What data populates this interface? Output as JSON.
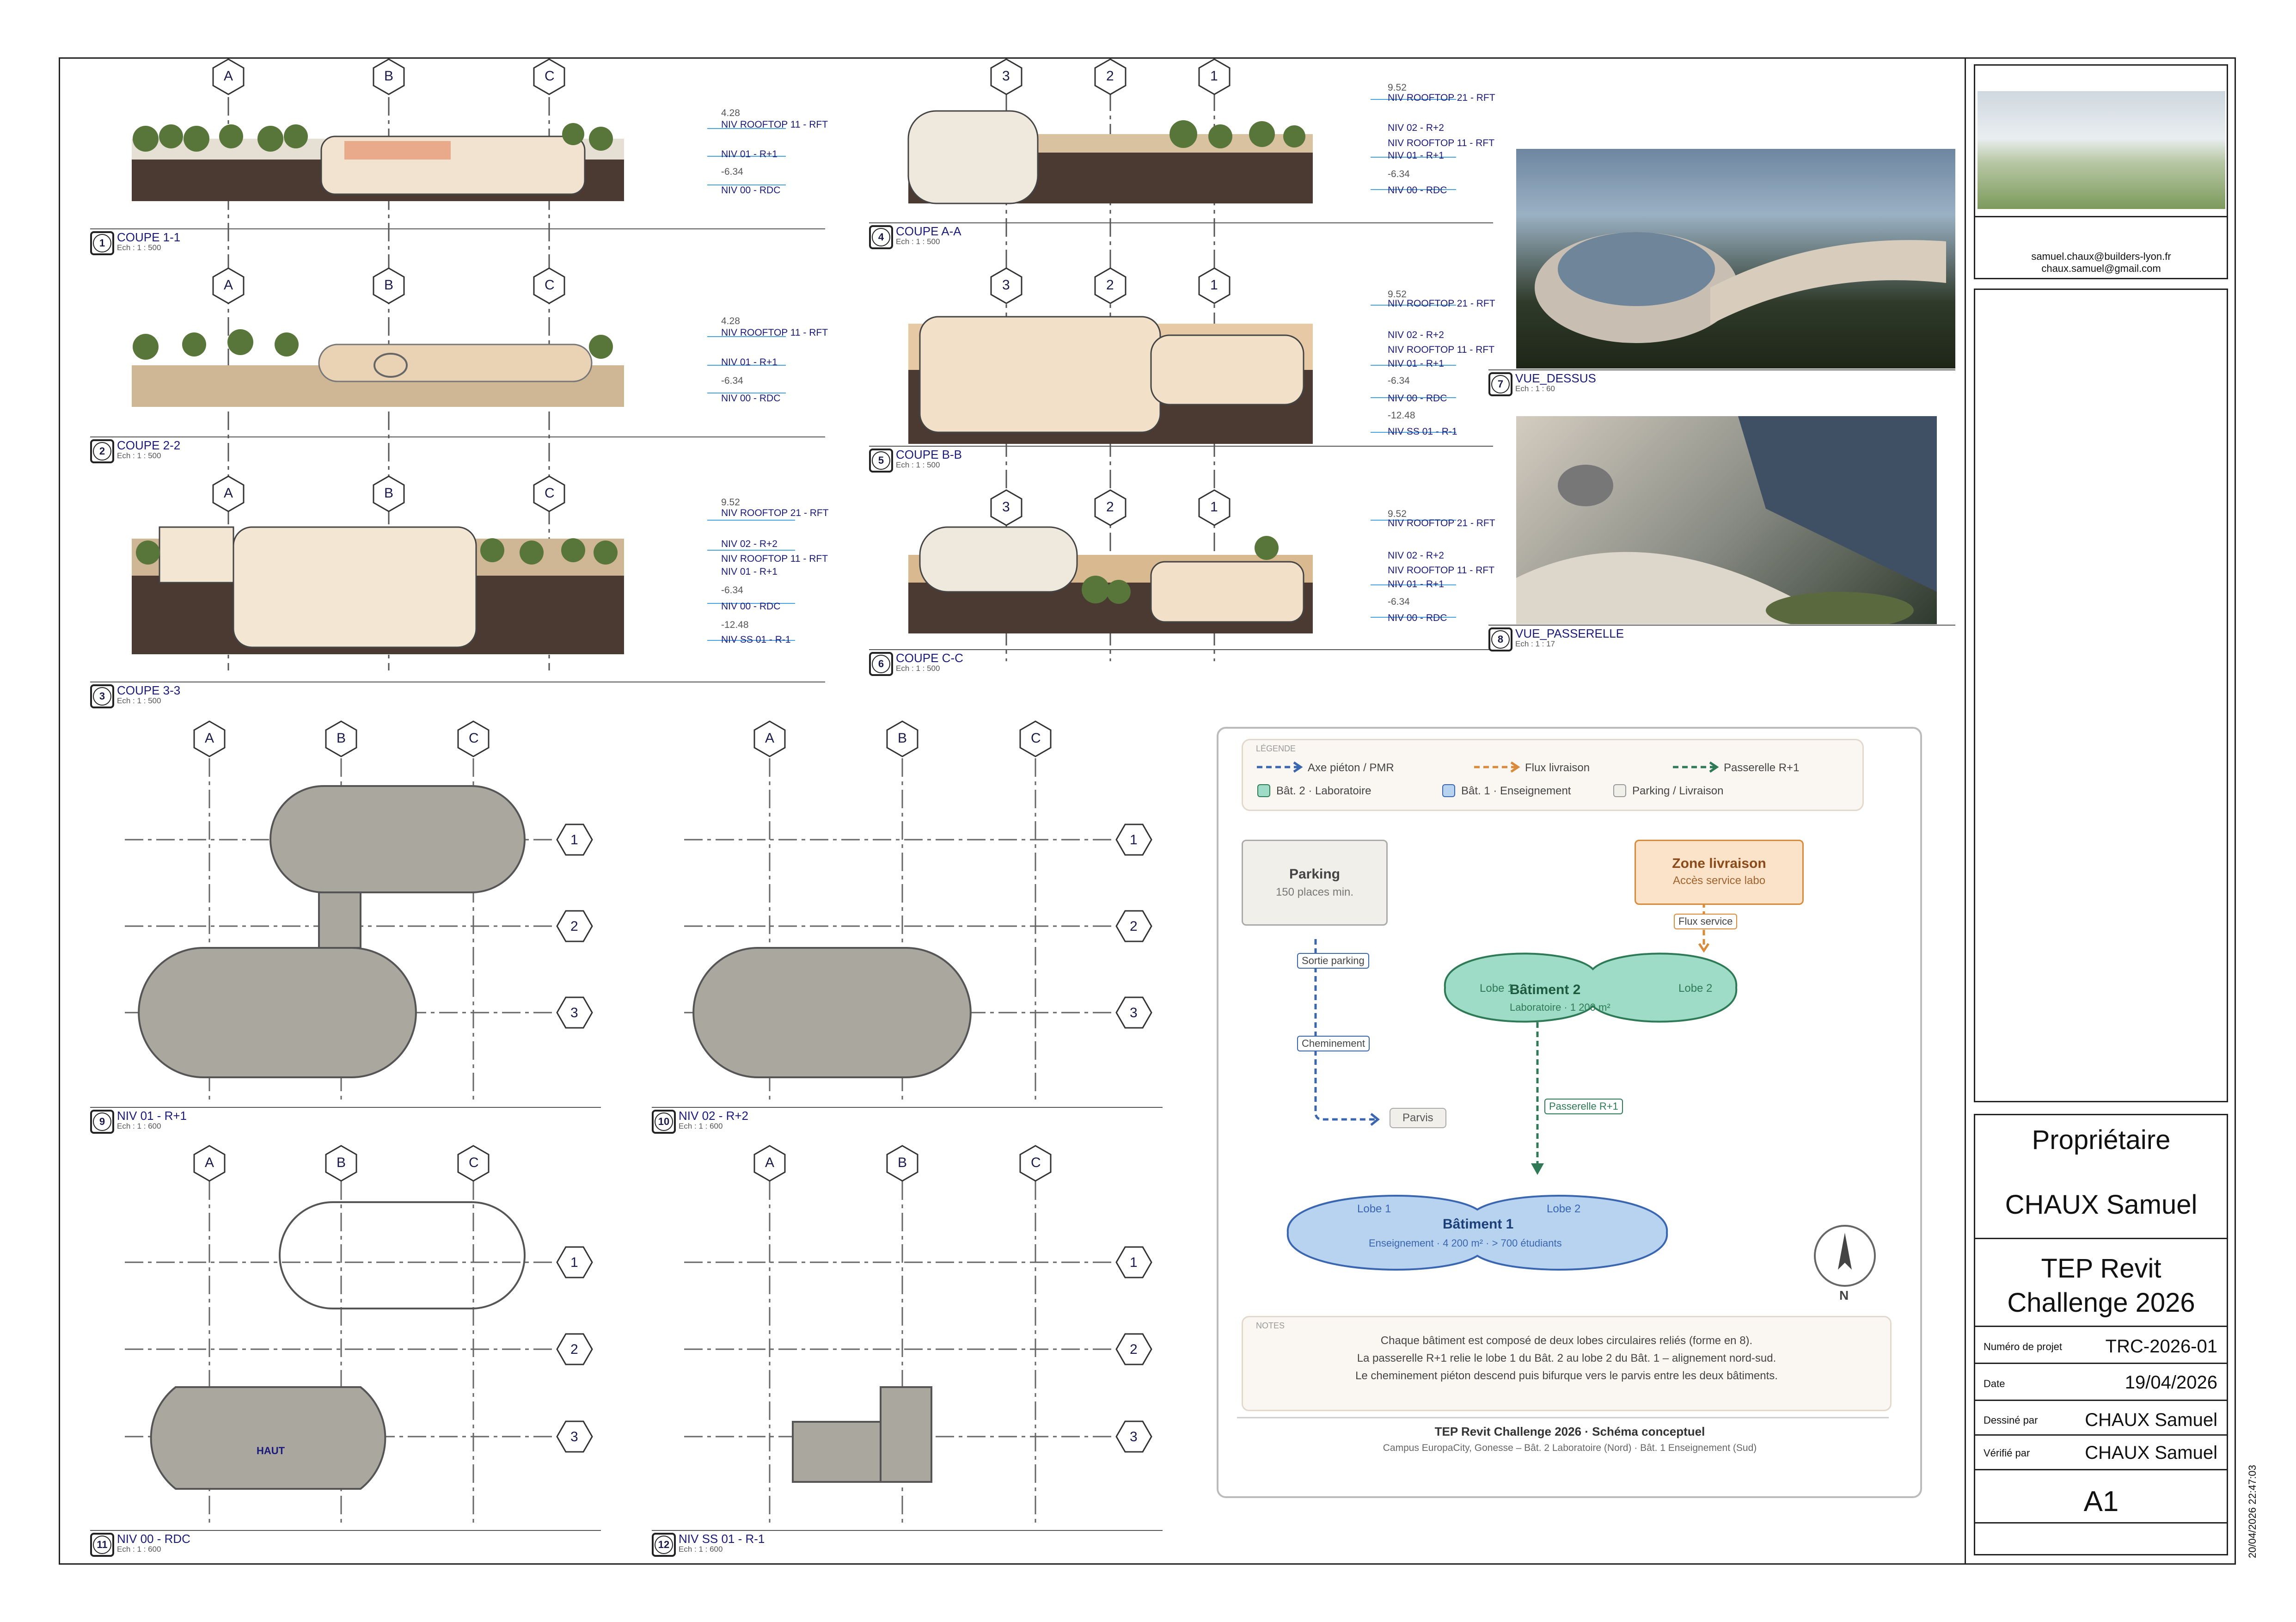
{
  "grid_letters": [
    "A",
    "B",
    "C"
  ],
  "grid_numbers": [
    "3",
    "2",
    "1"
  ],
  "plan_grid_numbers": [
    "1",
    "2",
    "3"
  ],
  "sections": {
    "coupe_1_1": {
      "num": "1",
      "name": "COUPE 1-1",
      "scale": "Ech : 1 : 500",
      "levels": [
        {
          "value": "4.28",
          "label": "NIV ROOFTOP 11 - RFT"
        },
        {
          "value": "",
          "label": "NIV 01 - R+1"
        },
        {
          "value": "-6.34",
          "label": "NIV 00 - RDC"
        }
      ]
    },
    "coupe_2_2": {
      "num": "2",
      "name": "COUPE 2-2",
      "scale": "Ech : 1 : 500",
      "levels": [
        {
          "value": "4.28",
          "label": "NIV ROOFTOP 11 - RFT"
        },
        {
          "value": "",
          "label": "NIV 01 - R+1"
        },
        {
          "value": "-6.34",
          "label": "NIV 00 - RDC"
        }
      ]
    },
    "coupe_3_3": {
      "num": "3",
      "name": "COUPE 3-3",
      "scale": "Ech : 1 : 500",
      "levels": [
        {
          "value": "9.52",
          "label": "NIV ROOFTOP 21 - RFT"
        },
        {
          "value": "",
          "label": "NIV 02 - R+2"
        },
        {
          "value": "",
          "label": "NIV ROOFTOP 11 - RFT"
        },
        {
          "value": "",
          "label": "NIV 01 - R+1"
        },
        {
          "value": "",
          "label": "NIV 00 - RDC"
        },
        {
          "value": "-6.34",
          "label": ""
        },
        {
          "value": "-12.48",
          "label": "NIV SS 01 - R-1"
        }
      ]
    },
    "coupe_a_a": {
      "num": "4",
      "name": "COUPE A-A",
      "scale": "Ech : 1 : 500",
      "levels": [
        {
          "value": "9.52",
          "label": "NIV ROOFTOP 21 - RFT"
        },
        {
          "value": "",
          "label": "NIV 02 - R+2"
        },
        {
          "value": "",
          "label": "NIV ROOFTOP 11 - RFT"
        },
        {
          "value": "",
          "label": "NIV 01 - R+1"
        },
        {
          "value": "-6.34",
          "label": "NIV 00 - RDC"
        }
      ]
    },
    "coupe_b_b": {
      "num": "5",
      "name": "COUPE B-B",
      "scale": "Ech : 1 : 500",
      "levels": [
        {
          "value": "9.52",
          "label": "NIV ROOFTOP 21 - RFT"
        },
        {
          "value": "",
          "label": "NIV 02 - R+2"
        },
        {
          "value": "",
          "label": "NIV ROOFTOP 11 - RFT"
        },
        {
          "value": "",
          "label": "NIV 01 - R+1"
        },
        {
          "value": "",
          "label": "NIV 00 - RDC"
        },
        {
          "value": "-6.34",
          "label": ""
        },
        {
          "value": "-12.48",
          "label": "NIV SS 01 - R-1"
        }
      ]
    },
    "coupe_c_c": {
      "num": "6",
      "name": "COUPE C-C",
      "scale": "Ech : 1 : 500",
      "levels": [
        {
          "value": "9.52",
          "label": "NIV ROOFTOP 21 - RFT"
        },
        {
          "value": "",
          "label": "NIV 02 - R+2"
        },
        {
          "value": "",
          "label": "NIV ROOFTOP 11 - RFT"
        },
        {
          "value": "",
          "label": "NIV 01 - R+1"
        },
        {
          "value": "-6.34",
          "label": "NIV 00 - RDC"
        }
      ]
    }
  },
  "views": {
    "vue_dessus": {
      "num": "7",
      "name": "VUE_DESSUS",
      "scale": "Ech : 1 : 60"
    },
    "vue_passerelle": {
      "num": "8",
      "name": "VUE_PASSERELLE",
      "scale": "Ech : 1 : 17"
    }
  },
  "plans": {
    "niv01": {
      "num": "9",
      "name": "NIV 01 - R+1",
      "scale": "Ech : 1 : 600"
    },
    "niv02": {
      "num": "10",
      "name": "NIV 02 - R+2",
      "scale": "Ech : 1 : 600"
    },
    "niv00": {
      "num": "11",
      "name": "NIV 00 - RDC",
      "scale": "Ech : 1 : 600",
      "tag": "HAUT"
    },
    "nivss01": {
      "num": "12",
      "name": "NIV SS 01 - R-1",
      "scale": "Ech : 1 : 600"
    }
  },
  "diagram": {
    "legend_title": "LÉGENDE",
    "legend": [
      {
        "label": "Axe piéton / PMR",
        "color": "#3a66b0"
      },
      {
        "label": "Flux livraison",
        "color": "#d98a3a"
      },
      {
        "label": "Passerelle R+1",
        "color": "#2e7a56"
      },
      {
        "label": "Bât. 2 · Laboratoire",
        "color": "#9fdcc8"
      },
      {
        "label": "Bât. 1 · Enseignement",
        "color": "#b8d3f0"
      },
      {
        "label": "Parking / Livraison",
        "color": "#f1efea"
      }
    ],
    "parking_title": "Parking",
    "parking_sub": "150 places min.",
    "livraison_title": "Zone livraison",
    "livraison_sub": "Accès service labo",
    "flux_service": "Flux service",
    "sortie_parking": "Sortie parking",
    "cheminement": "Cheminement",
    "parvis": "Parvis",
    "passerelle": "Passerelle R+1",
    "bat2_title": "Bâtiment 2",
    "bat2_sub": "Laboratoire · 1 200 m²",
    "bat2_lobe1": "Lobe 1",
    "bat2_lobe2": "Lobe 2",
    "bat1_title": "Bâtiment 1",
    "bat1_sub": "Enseignement · 4 200 m² · > 700 étudiants",
    "bat1_lobe1": "Lobe 1",
    "bat1_lobe2": "Lobe 2",
    "north": "N",
    "notes_title": "NOTES",
    "notes": [
      "Chaque bâtiment est composé de deux lobes circulaires reliés (forme en 8).",
      "La passerelle R+1 relie le lobe 1 du Bât. 2 au lobe 2 du Bât. 1 – alignement nord-sud.",
      "Le cheminement piéton descend puis bifurque vers le parvis entre les deux bâtiments."
    ],
    "footer_title": "TEP Revit Challenge 2026 · Schéma conceptuel",
    "footer_sub": "Campus EuropaCity, Gonesse – Bât. 2 Laboratoire (Nord) · Bât. 1 Enseignement (Sud)"
  },
  "titleblock": {
    "email1": "samuel.chaux@builders-lyon.fr",
    "email2": "chaux.samuel@gmail.com",
    "owner_label": "Propriétaire",
    "owner_name": "CHAUX Samuel",
    "project_title_1": "TEP Revit",
    "project_title_2": "Challenge 2026",
    "rows": [
      {
        "label": "Numéro de projet",
        "value": "TRC-2026-01"
      },
      {
        "label": "Date",
        "value": "19/04/2026"
      },
      {
        "label": "Dessiné par",
        "value": "CHAUX Samuel"
      },
      {
        "label": "Vérifié par",
        "value": "CHAUX Samuel"
      }
    ],
    "sheet_number": "A1",
    "timestamp": "20/04/2026 22:47:03"
  }
}
